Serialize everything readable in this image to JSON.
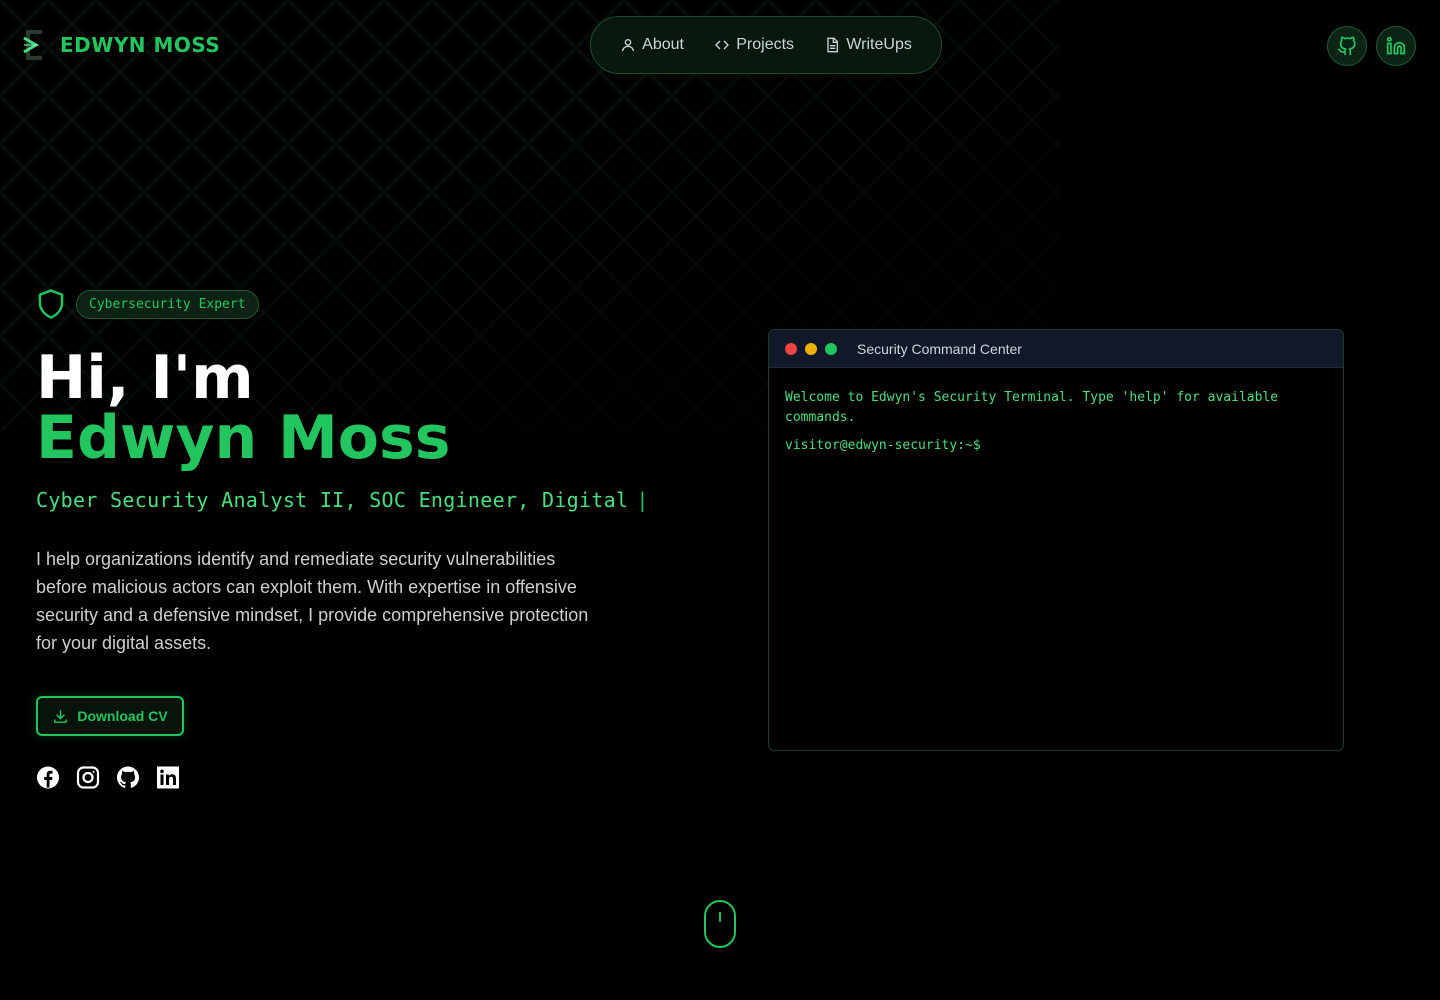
{
  "header": {
    "logo_text": "EDWYN MOSS",
    "nav": [
      {
        "label": "About",
        "icon": "user-icon"
      },
      {
        "label": "Projects",
        "icon": "code-icon"
      },
      {
        "label": "WriteUps",
        "icon": "document-icon"
      }
    ],
    "social": [
      {
        "icon": "github-icon"
      },
      {
        "icon": "linkedin-icon"
      }
    ]
  },
  "hero": {
    "badge": "Cybersecurity Expert",
    "greeting": "Hi, I'm",
    "name": "Edwyn Moss",
    "roles": "Cyber Security Analyst II, SOC Engineer, Digital",
    "caret": "|",
    "description": "I help organizations identify and remediate security vulnerabilities before malicious actors can exploit them. With expertise in offensive security and a defensive mindset, I provide comprehensive protection for your digital assets.",
    "cv_button": "Download CV",
    "socials": [
      "facebook-icon",
      "instagram-icon",
      "github-icon",
      "linkedin-icon"
    ]
  },
  "terminal": {
    "title": "Security Command Center",
    "welcome": "Welcome to Edwyn's Security Terminal. Type 'help' for available commands.",
    "prompt": "visitor@edwyn-security:~$"
  },
  "colors": {
    "accent": "#22c55e",
    "background": "#000000",
    "dot_red": "#ef4444",
    "dot_yellow": "#eab308",
    "dot_green": "#22c55e"
  }
}
